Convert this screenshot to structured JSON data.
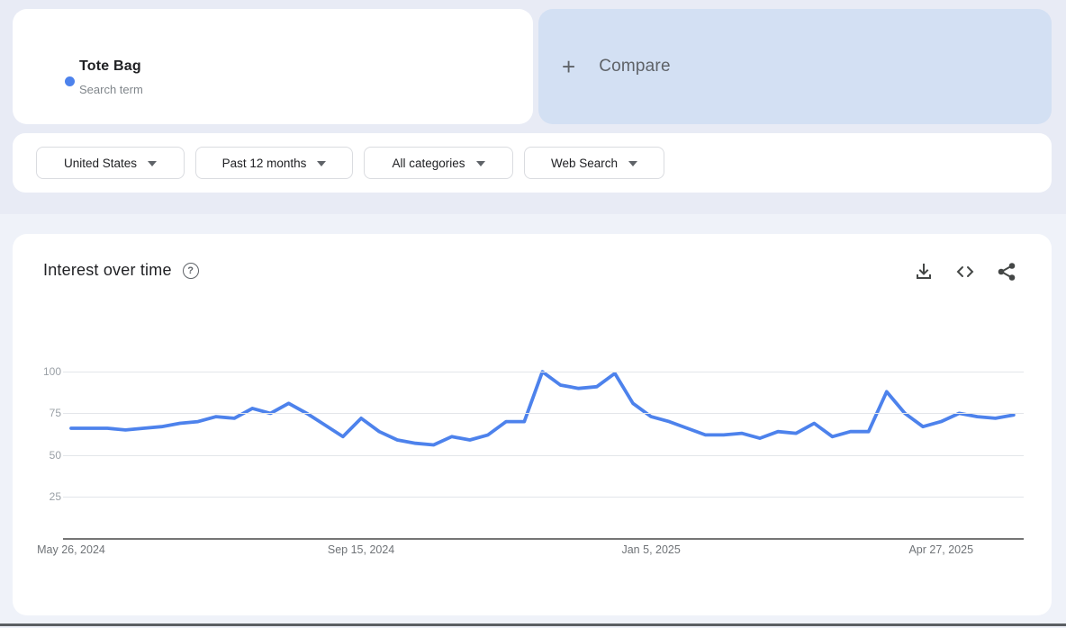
{
  "term_card": {
    "term": "Tote Bag",
    "type_label": "Search term",
    "dot_color": "#4d82ec"
  },
  "compare_card": {
    "plus": "+",
    "label": "Compare"
  },
  "filters": [
    {
      "label": "United States"
    },
    {
      "label": "Past 12 months"
    },
    {
      "label": "All categories"
    },
    {
      "label": "Web Search"
    }
  ],
  "chart_section": {
    "title": "Interest over time",
    "help_symbol": "?",
    "toolbar_icons": [
      "download-icon",
      "embed-icon",
      "share-icon"
    ]
  },
  "chart_data": {
    "type": "line",
    "title": "Interest over time",
    "series": [
      {
        "name": "Tote Bag",
        "color": "#4d82ec",
        "values": [
          66,
          66,
          66,
          65,
          66,
          67,
          69,
          70,
          73,
          72,
          78,
          75,
          81,
          75,
          68,
          61,
          72,
          64,
          59,
          57,
          56,
          61,
          59,
          62,
          70,
          70,
          100,
          92,
          90,
          91,
          99,
          81,
          73,
          70,
          66,
          62,
          62,
          63,
          60,
          64,
          63,
          69,
          61,
          64,
          64,
          88,
          75,
          67,
          70,
          75,
          73,
          72,
          74
        ]
      }
    ],
    "x_start": "May 26, 2024",
    "x_interval": "weekly",
    "x_tick_labels": [
      "May 26, 2024",
      "Sep 15, 2024",
      "Jan 5, 2025",
      "Apr 27, 2025"
    ],
    "x_tick_indices": [
      0,
      16,
      32,
      48
    ],
    "y_ticks": [
      100,
      75,
      50,
      25
    ],
    "ylim": [
      0,
      100
    ],
    "grid": "horizontal",
    "legend": "none"
  },
  "colors": {
    "page_top_bg": "#e8ebf5",
    "page_bottom_bg": "#eff2f9",
    "compare_bg": "#d3e0f3",
    "accent_blue": "#4d82ec",
    "gridline": "#e3e6ea",
    "axis": "#757575"
  }
}
